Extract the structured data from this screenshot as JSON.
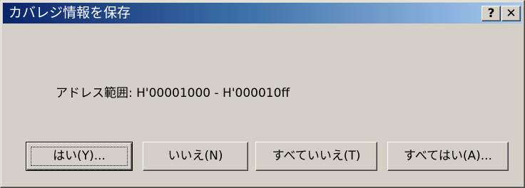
{
  "window": {
    "title": "カバレジ情報を保存",
    "help_label": "?",
    "close_label": "✕"
  },
  "message": "アドレス範囲: H'00001000 - H'000010ff",
  "buttons": {
    "yes": "はい(Y)...",
    "no": "いいえ(N)",
    "no_to_all": "すべていいえ(T)",
    "yes_to_all": "すべてはい(A)..."
  },
  "colors": {
    "title_gradient_start": "#0a246a",
    "title_gradient_end": "#a6caf0",
    "face": "#d4d0c8"
  }
}
